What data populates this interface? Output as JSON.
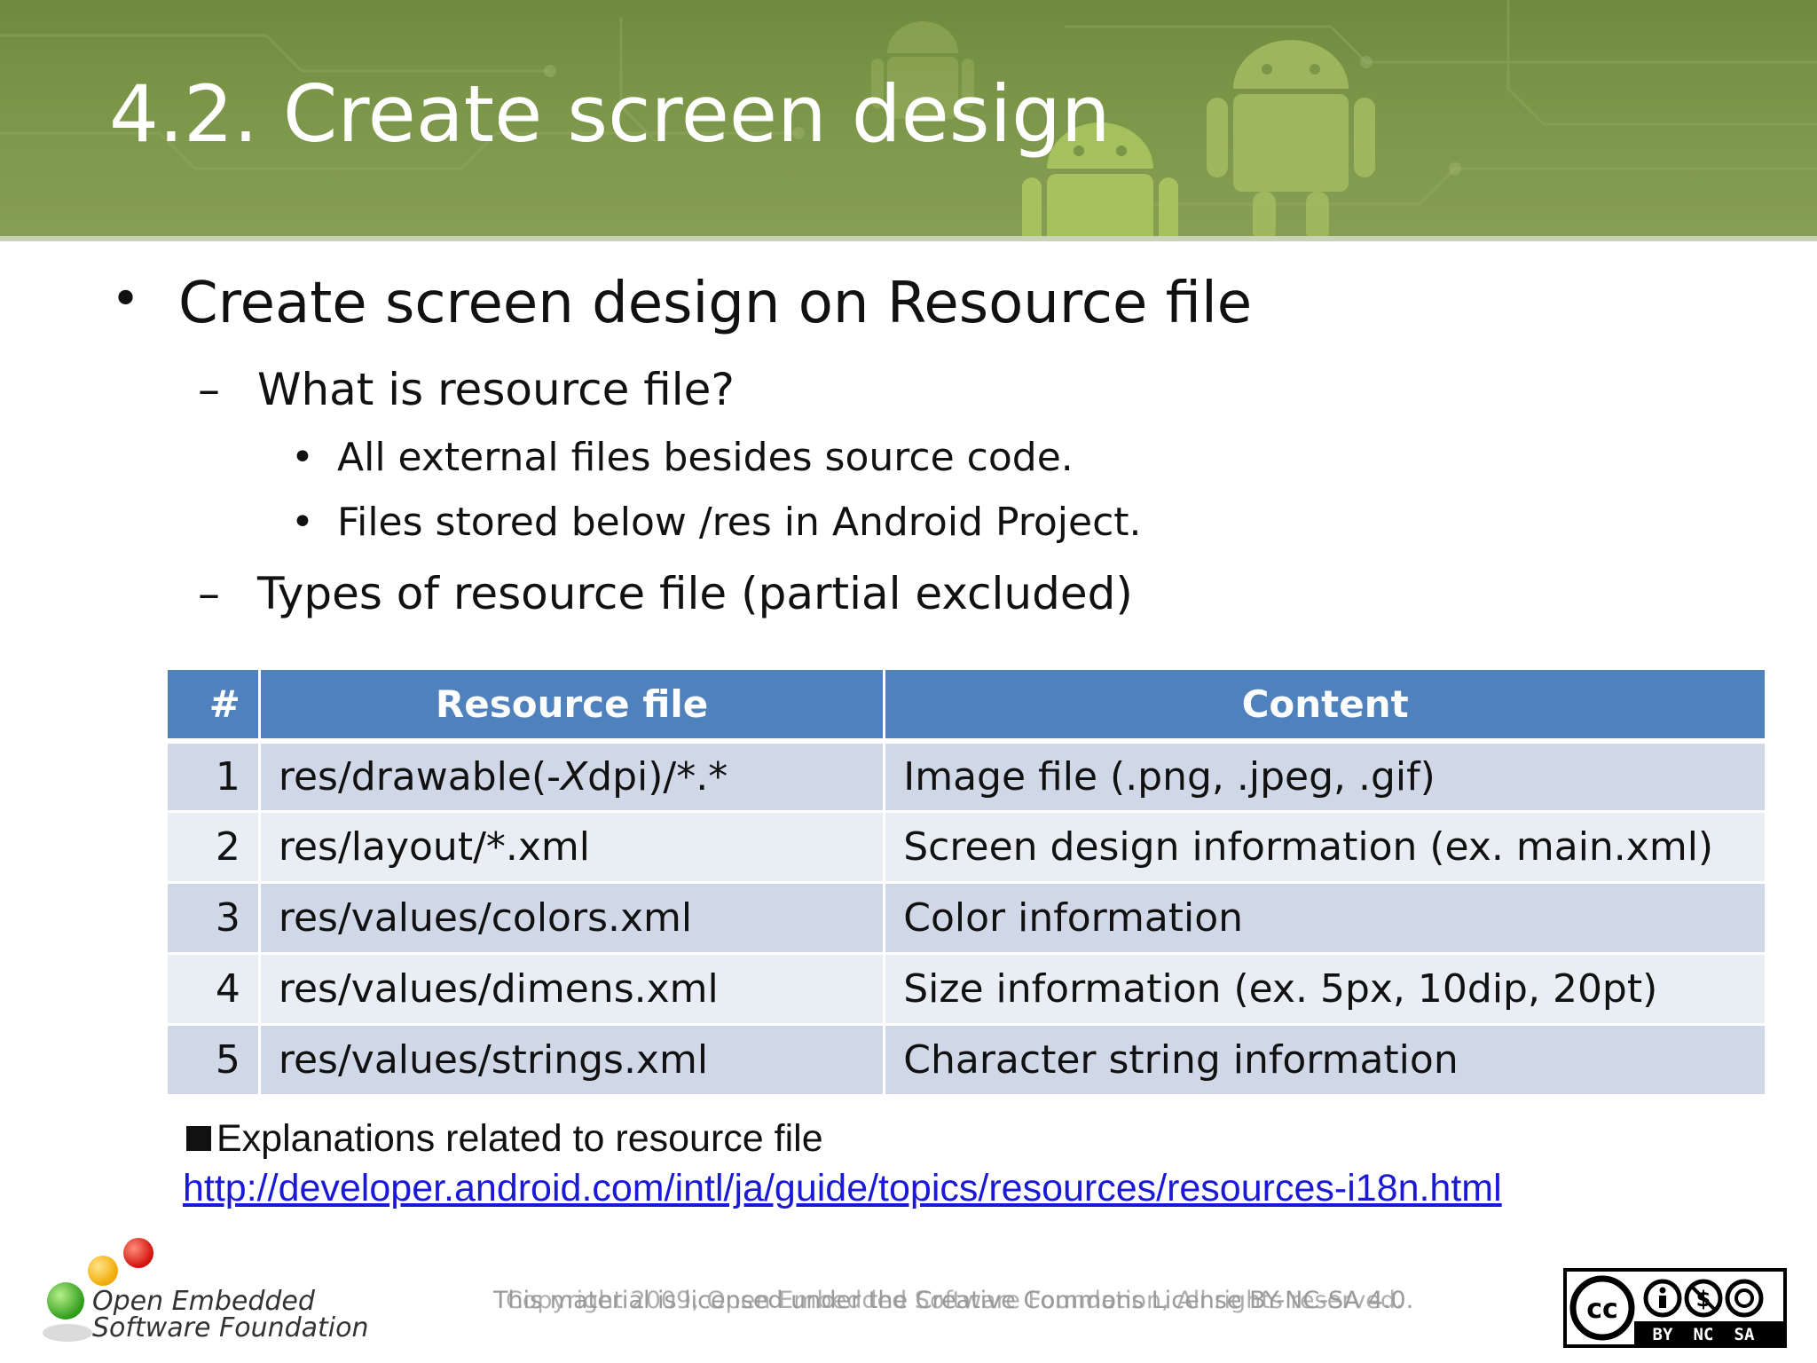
{
  "header": {
    "title": "4.2. Create screen design"
  },
  "bullets": {
    "level1": "Create screen design on Resource file",
    "sub1": "What is resource file?",
    "sub1_items": [
      "All external files besides source code.",
      "Files stored below /res  in Android Project."
    ],
    "sub2": "Types of resource file (partial excluded)",
    "marks": {
      "dot": "•",
      "dash": "–"
    }
  },
  "table": {
    "headers": [
      "#",
      "Resource file",
      "Content"
    ],
    "rows": [
      {
        "num": "1",
        "file_pre": "res/drawable(-",
        "file_italic": "X",
        "file_post": "dpi)/*.*",
        "content": "Image file (.png, .jpeg, .gif)"
      },
      {
        "num": "2",
        "file": "res/layout/*.xml",
        "content": "Screen design information (ex. main.xml)"
      },
      {
        "num": "3",
        "file": "res/values/colors.xml",
        "content": "Color information"
      },
      {
        "num": "4",
        "file": "res/values/dimens.xml",
        "content": "Size information (ex. 5px, 10dip, 20pt)"
      },
      {
        "num": "5",
        "file": "res/values/strings.xml",
        "content": "Character string information"
      }
    ],
    "colors": {
      "header": "#4f81bd",
      "odd": "#d0d8e8",
      "even": "#e9edf4"
    }
  },
  "note": {
    "text": "Explanations related to resource file",
    "link": "http://developer.android.com/intl/ja/guide/topics/resources/resources-i18n.html"
  },
  "footer": {
    "org_line1": "Open Embedded",
    "org_line2": "Software Foundation",
    "copyright_a": "This material is licensed under the Creative Commons License BY-NC-SA 4.0.",
    "copyright_b": "Copyright 2009, Open Embedded Software Foundation, All rights reserved.",
    "license_labels": [
      "BY",
      "NC",
      "SA"
    ],
    "license_logo": "cc"
  }
}
